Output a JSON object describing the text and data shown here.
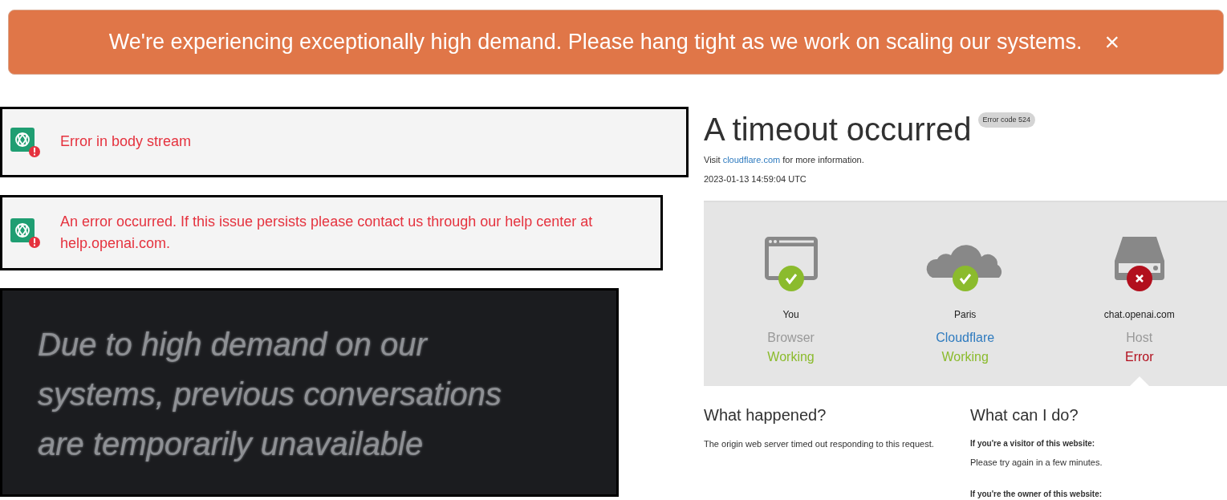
{
  "banner": {
    "text": "We're experiencing exceptionally high demand. Please hang tight as we work on scaling our systems.",
    "close": "×"
  },
  "chat_errors": [
    {
      "text": "Error in body stream"
    },
    {
      "text": "An error occurred. If this issue persists please contact us through our help center at help.openai.com."
    }
  ],
  "notice": {
    "text": "Due to high demand on our systems, previous conversations are temporarily unavailable"
  },
  "cloudflare": {
    "title": "A timeout occurred",
    "error_code": "Error code 524",
    "visit": {
      "before": "Visit",
      "link": "cloudflare.com",
      "after": "for more information."
    },
    "timestamp": "2023-01-13 14:59:04 UTC",
    "statuses": [
      {
        "kind": "browser",
        "location": "You",
        "name": "Browser",
        "link": false,
        "ok": true,
        "status": "Working",
        "selected": false
      },
      {
        "kind": "cloud",
        "location": "Paris",
        "name": "Cloudflare",
        "link": true,
        "ok": true,
        "status": "Working",
        "selected": false
      },
      {
        "kind": "server",
        "location": "chat.openai.com",
        "name": "Host",
        "link": false,
        "ok": false,
        "status": "Error",
        "selected": true
      }
    ],
    "what_happened": {
      "heading": "What happened?",
      "text": "The origin web server timed out responding to this request."
    },
    "what_can_i_do": {
      "heading": "What can I do?",
      "visitor_label": "If you're a visitor of this website:",
      "visitor_text": "Please try again in a few minutes.",
      "owner_label": "If you're the owner of this website:"
    }
  }
}
